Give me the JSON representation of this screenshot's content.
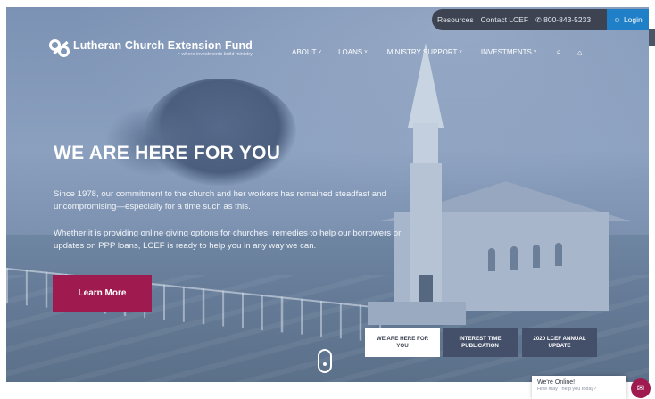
{
  "utility": {
    "resources": "Resources",
    "contact": "Contact LCEF",
    "phone": "800-843-5233",
    "phone_icon": "phone-icon",
    "login": "Login",
    "login_icon": "user-icon"
  },
  "logo": {
    "name": "Lutheran Church Extension Fund",
    "tagline": "> where investments build ministry"
  },
  "nav": {
    "items": [
      {
        "label": "ABOUT"
      },
      {
        "label": "LOANS"
      },
      {
        "label": "MINISTRY SUPPORT"
      },
      {
        "label": "INVESTMENTS"
      }
    ],
    "search_icon": "search-icon",
    "extra_icon": "graduation-cap-icon"
  },
  "hero": {
    "headline": "WE ARE HERE FOR YOU",
    "paragraph1": "Since 1978, our commitment to the church and her workers has remained steadfast and uncompromising—especially for a time such as this.",
    "paragraph2": "Whether it is providing online giving options for churches, remedies to help our borrowers or updates on PPP loans, LCEF is ready to help you in any way we can.",
    "cta": "Learn More"
  },
  "slides": [
    {
      "label": "WE ARE HERE FOR YOU",
      "active": true
    },
    {
      "label": "INTEREST TIME PUBLICATION",
      "active": false
    },
    {
      "label": "2020 LCEF ANNUAL UPDATE",
      "active": false
    }
  ],
  "chat": {
    "status": "We're Online!",
    "prompt": "How may I help you today?"
  },
  "colors": {
    "brand_accent": "#9e1a4f",
    "login_blue": "#1f7fc7",
    "utility_bar": "#3d4351",
    "hero_tint": "#7c92b4"
  }
}
